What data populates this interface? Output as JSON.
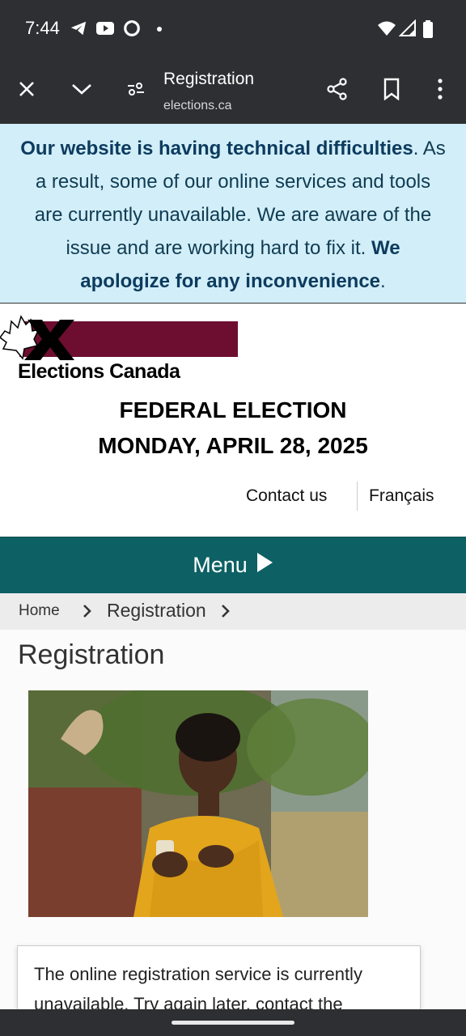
{
  "status_bar": {
    "time": "7:44",
    "icons": [
      "telegram-icon",
      "youtube-icon",
      "sync-app-icon",
      "dot-icon",
      "wifi-icon",
      "signal-icon",
      "battery-icon"
    ]
  },
  "browser": {
    "title": "Registration",
    "url": "elections.ca",
    "icons": [
      "close-icon",
      "chevron-down-icon",
      "site-settings-icon",
      "share-icon",
      "bookmark-icon",
      "more-vert-icon"
    ]
  },
  "alert": {
    "bold_lead": "Our website is having technical difficulties",
    "lead_punct": ".",
    "body": " As a result, some of our online services and tools are currently unavailable. We are aware of the issue and are working hard to fix it. ",
    "bold_tail": "We apologize for any inconvenience",
    "tail_punct": "."
  },
  "logo": {
    "text": "Elections Canada",
    "colors": {
      "bar": "#6d0e30",
      "x": "#000000"
    }
  },
  "headline": {
    "line1": "FEDERAL ELECTION",
    "line2": "MONDAY, APRIL 28, 2025"
  },
  "links": {
    "contact": "Contact us",
    "language": "Français"
  },
  "menu": {
    "label": "Menu",
    "color": "#0d6064"
  },
  "breadcrumb": {
    "items": [
      "Home",
      "Registration"
    ]
  },
  "page": {
    "title": "Registration"
  },
  "notice": {
    "line1": "The online registration service is currently",
    "line2": "unavailable. Try again later, contact the"
  }
}
